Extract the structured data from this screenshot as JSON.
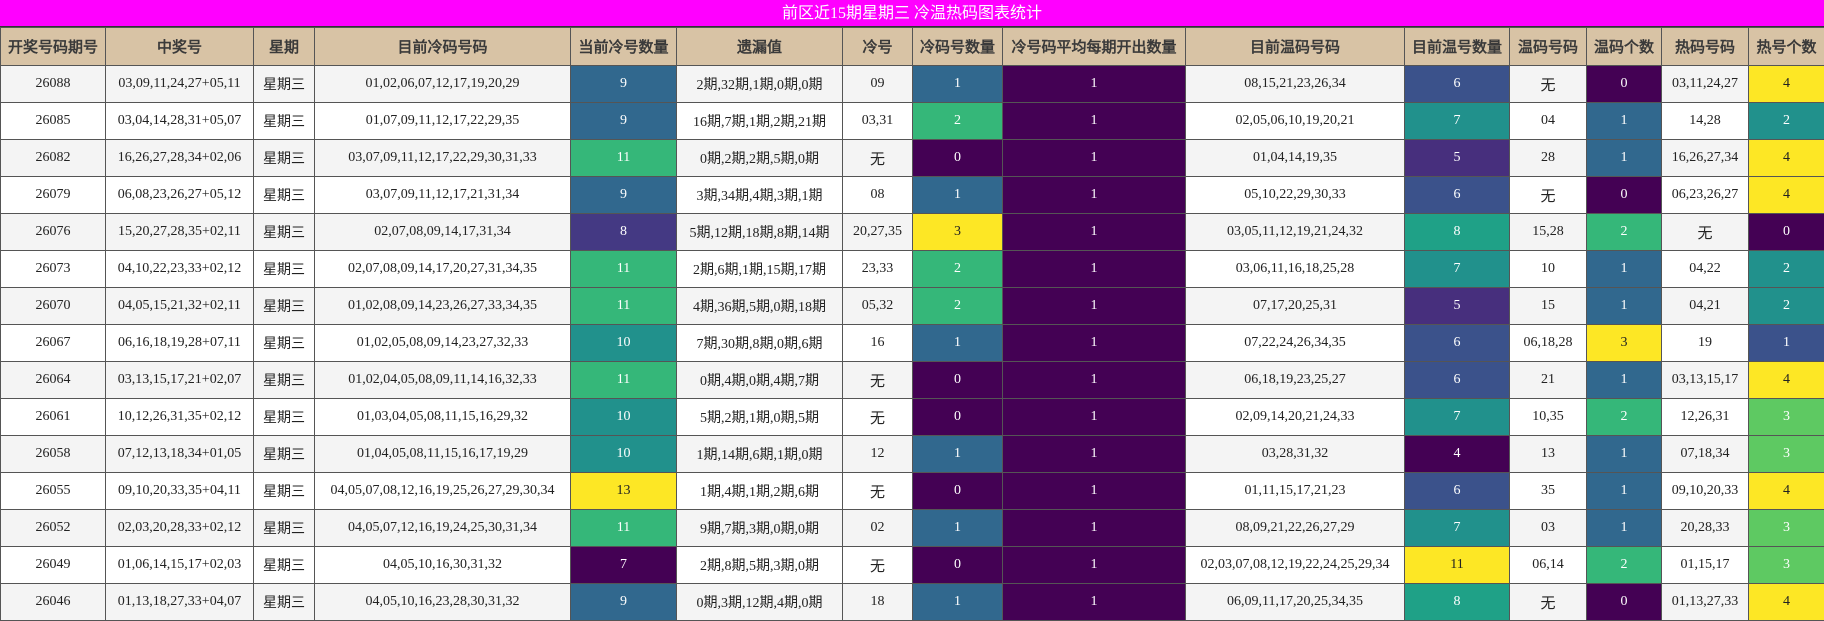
{
  "title": "前区近15期星期三 冷温热码图表统计",
  "headers": [
    "开奖号码期号",
    "中奖号",
    "星期",
    "目前冷码号码",
    "当前冷号数量",
    "遗漏值",
    "冷号",
    "冷码号数量",
    "冷号码平均每期开出数量",
    "目前温码号码",
    "目前温号数量",
    "温码号码",
    "温码个数",
    "热码号码",
    "热号个数"
  ],
  "scale_colors": {
    "0": "#440154",
    "1": "#31688e",
    "2": "#35b779",
    "3": "#fde725"
  },
  "scale_cold": {
    "7": "#440154",
    "8": "#443983",
    "9": "#31688e",
    "10": "#21918c",
    "11": "#35b779",
    "13": "#fde725"
  },
  "scale_warm": {
    "4": "#440154",
    "5": "#472f7d",
    "6": "#3b528b",
    "7": "#21918c",
    "8": "#1fa187",
    "11": "#fde725"
  },
  "scale_hot": {
    "0": "#440154",
    "1": "#3b528b",
    "2": "#21918c",
    "3": "#5ec962",
    "4": "#fde725"
  },
  "rows": [
    [
      "26088",
      "03,09,11,24,27+05,11",
      "星期三",
      "01,02,06,07,12,17,19,20,29",
      "9",
      "2期,32期,1期,0期,0期",
      "09",
      "1",
      "1",
      "08,15,21,23,26,34",
      "6",
      "无",
      "0",
      "03,11,24,27",
      "4"
    ],
    [
      "26085",
      "03,04,14,28,31+05,07",
      "星期三",
      "01,07,09,11,12,17,22,29,35",
      "9",
      "16期,7期,1期,2期,21期",
      "03,31",
      "2",
      "1",
      "02,05,06,10,19,20,21",
      "7",
      "04",
      "1",
      "14,28",
      "2"
    ],
    [
      "26082",
      "16,26,27,28,34+02,06",
      "星期三",
      "03,07,09,11,12,17,22,29,30,31,33",
      "11",
      "0期,2期,2期,5期,0期",
      "无",
      "0",
      "1",
      "01,04,14,19,35",
      "5",
      "28",
      "1",
      "16,26,27,34",
      "4"
    ],
    [
      "26079",
      "06,08,23,26,27+05,12",
      "星期三",
      "03,07,09,11,12,17,21,31,34",
      "9",
      "3期,34期,4期,3期,1期",
      "08",
      "1",
      "1",
      "05,10,22,29,30,33",
      "6",
      "无",
      "0",
      "06,23,26,27",
      "4"
    ],
    [
      "26076",
      "15,20,27,28,35+02,11",
      "星期三",
      "02,07,08,09,14,17,31,34",
      "8",
      "5期,12期,18期,8期,14期",
      "20,27,35",
      "3",
      "1",
      "03,05,11,12,19,21,24,32",
      "8",
      "15,28",
      "2",
      "无",
      "0"
    ],
    [
      "26073",
      "04,10,22,23,33+02,12",
      "星期三",
      "02,07,08,09,14,17,20,27,31,34,35",
      "11",
      "2期,6期,1期,15期,17期",
      "23,33",
      "2",
      "1",
      "03,06,11,16,18,25,28",
      "7",
      "10",
      "1",
      "04,22",
      "2"
    ],
    [
      "26070",
      "04,05,15,21,32+02,11",
      "星期三",
      "01,02,08,09,14,23,26,27,33,34,35",
      "11",
      "4期,36期,5期,0期,18期",
      "05,32",
      "2",
      "1",
      "07,17,20,25,31",
      "5",
      "15",
      "1",
      "04,21",
      "2"
    ],
    [
      "26067",
      "06,16,18,19,28+07,11",
      "星期三",
      "01,02,05,08,09,14,23,27,32,33",
      "10",
      "7期,30期,8期,0期,6期",
      "16",
      "1",
      "1",
      "07,22,24,26,34,35",
      "6",
      "06,18,28",
      "3",
      "19",
      "1"
    ],
    [
      "26064",
      "03,13,15,17,21+02,07",
      "星期三",
      "01,02,04,05,08,09,11,14,16,32,33",
      "11",
      "0期,4期,0期,4期,7期",
      "无",
      "0",
      "1",
      "06,18,19,23,25,27",
      "6",
      "21",
      "1",
      "03,13,15,17",
      "4"
    ],
    [
      "26061",
      "10,12,26,31,35+02,12",
      "星期三",
      "01,03,04,05,08,11,15,16,29,32",
      "10",
      "5期,2期,1期,0期,5期",
      "无",
      "0",
      "1",
      "02,09,14,20,21,24,33",
      "7",
      "10,35",
      "2",
      "12,26,31",
      "3"
    ],
    [
      "26058",
      "07,12,13,18,34+01,05",
      "星期三",
      "01,04,05,08,11,15,16,17,19,29",
      "10",
      "1期,14期,6期,1期,0期",
      "12",
      "1",
      "1",
      "03,28,31,32",
      "4",
      "13",
      "1",
      "07,18,34",
      "3"
    ],
    [
      "26055",
      "09,10,20,33,35+04,11",
      "星期三",
      "04,05,07,08,12,16,19,25,26,27,29,30,34",
      "13",
      "1期,4期,1期,2期,6期",
      "无",
      "0",
      "1",
      "01,11,15,17,21,23",
      "6",
      "35",
      "1",
      "09,10,20,33",
      "4"
    ],
    [
      "26052",
      "02,03,20,28,33+02,12",
      "星期三",
      "04,05,07,12,16,19,24,25,30,31,34",
      "11",
      "9期,7期,3期,0期,0期",
      "02",
      "1",
      "1",
      "08,09,21,22,26,27,29",
      "7",
      "03",
      "1",
      "20,28,33",
      "3"
    ],
    [
      "26049",
      "01,06,14,15,17+02,03",
      "星期三",
      "04,05,10,16,30,31,32",
      "7",
      "2期,8期,5期,3期,0期",
      "无",
      "0",
      "1",
      "02,03,07,08,12,19,22,24,25,29,34",
      "11",
      "06,14",
      "2",
      "01,15,17",
      "3"
    ],
    [
      "26046",
      "01,13,18,27,33+04,07",
      "星期三",
      "04,05,10,16,23,28,30,31,32",
      "9",
      "0期,3期,12期,4期,0期",
      "18",
      "1",
      "1",
      "06,09,11,17,20,25,34,35",
      "8",
      "无",
      "0",
      "01,13,27,33",
      "4"
    ]
  ]
}
